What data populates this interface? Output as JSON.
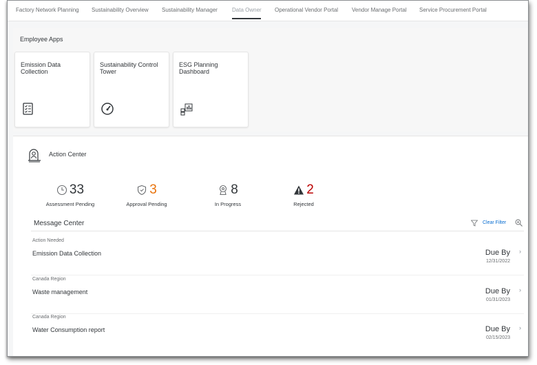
{
  "tabs": [
    {
      "label": "Factory Network Planning"
    },
    {
      "label": "Sustainability Overview"
    },
    {
      "label": "Sustainability Manager"
    },
    {
      "label": "Data Owner"
    },
    {
      "label": "Operational Vendor Portal"
    },
    {
      "label": "Vendor Manage Portal"
    },
    {
      "label": "Service Procurement Portal"
    }
  ],
  "employee_apps": {
    "title": "Employee Apps",
    "tiles": [
      {
        "title": "Emission Data Collection",
        "icon": "checklist-icon"
      },
      {
        "title": "Sustainability Control Tower",
        "icon": "gauge-icon"
      },
      {
        "title": "ESG Planning Dashboard",
        "icon": "dashboard-icon"
      }
    ]
  },
  "action_center": {
    "title": "Action Center",
    "kpis": [
      {
        "value": "33",
        "label": "Assessment Pending",
        "icon": "clock-icon",
        "color": "#32363a"
      },
      {
        "value": "3",
        "label": "Approval Pending",
        "icon": "shield-icon",
        "color": "#e9730c"
      },
      {
        "value": "8",
        "label": "In Progress",
        "icon": "progress-icon",
        "color": "#32363a"
      },
      {
        "value": "2",
        "label": "Rejected",
        "icon": "warning-icon",
        "color": "#bb0000"
      }
    ]
  },
  "message_center": {
    "title": "Message Center",
    "clear_filter": "Clear Filter",
    "messages": [
      {
        "category": "Action Needed",
        "name": "Emission Data Collection",
        "due_label": "Due By",
        "due_date": "12/31/2022"
      },
      {
        "category": "Canada Region",
        "name": "Waste management",
        "due_label": "Due By",
        "due_date": "01/31/2023"
      },
      {
        "category": "Canada Region",
        "name": "Water Consumption report",
        "due_label": "Due By",
        "due_date": "02/15/2023"
      }
    ]
  },
  "colors": {
    "accent": "#0a6ed1",
    "approval": "#e9730c",
    "rejected": "#bb0000"
  }
}
